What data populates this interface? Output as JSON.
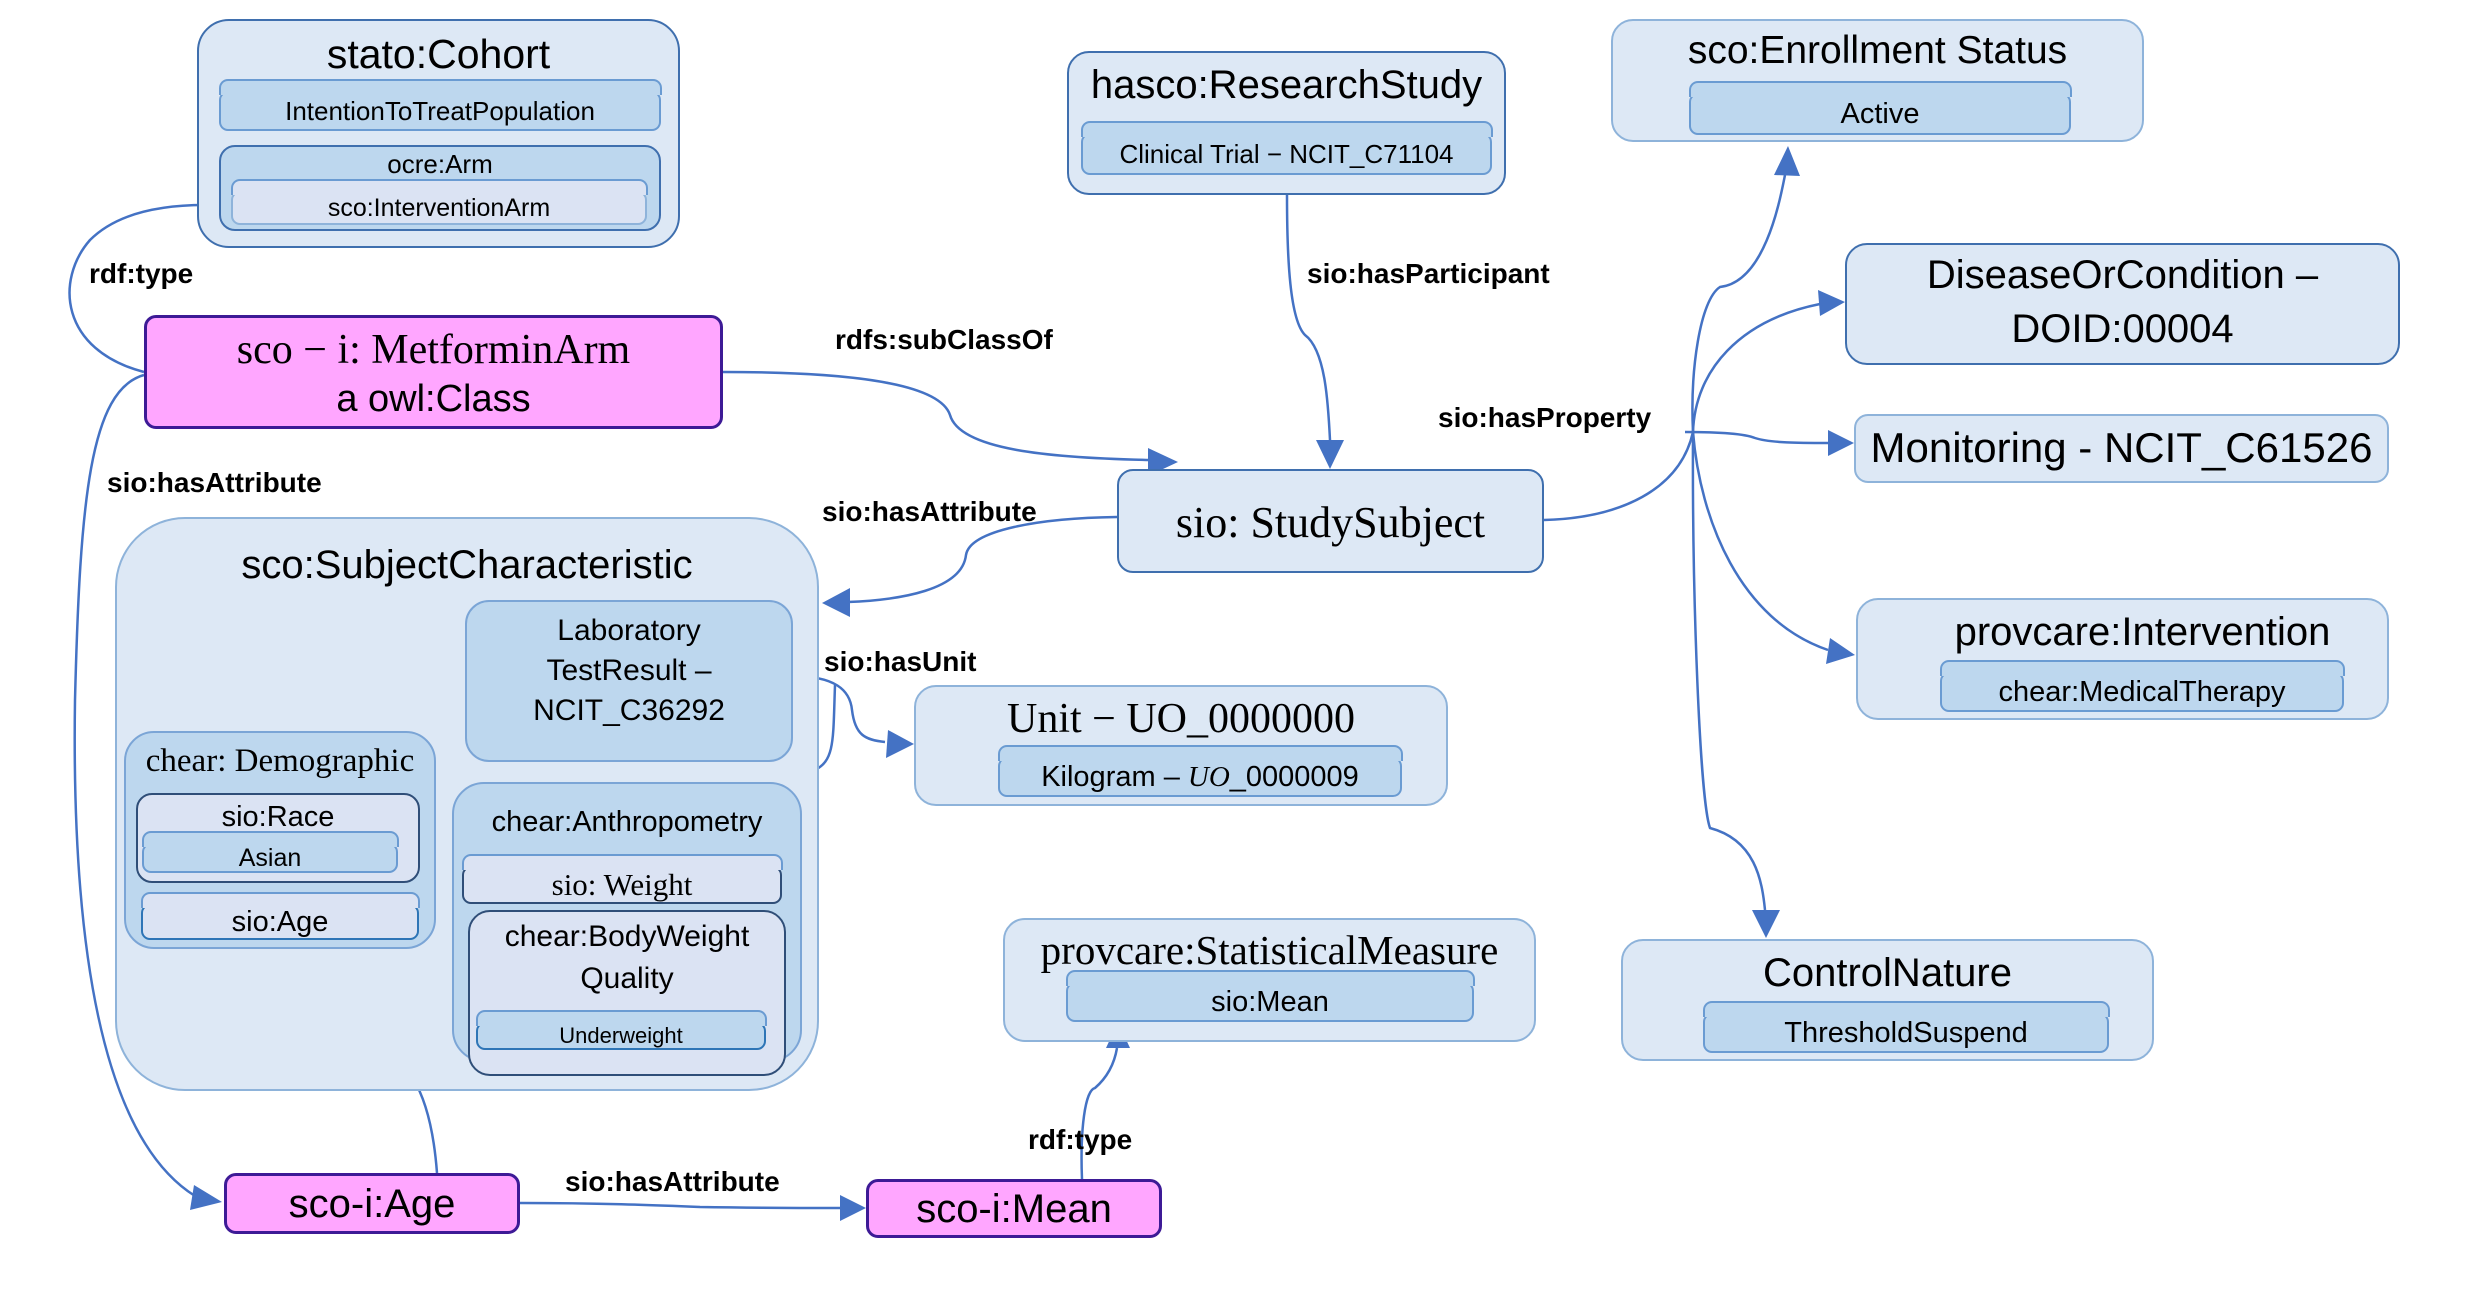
{
  "nodes": {
    "cohort": {
      "title": "stato:Cohort",
      "items": [
        "IntentionToTreatPopulation"
      ],
      "arm": {
        "title": "ocre:Arm",
        "item": "sco:InterventionArm"
      }
    },
    "research_study": {
      "title": "hasco:ResearchStudy",
      "item": "Clinical Trial − NCIT_C71104"
    },
    "enrollment_status": {
      "title": "sco:Enrollment Status",
      "item": "Active"
    },
    "disease": {
      "line1": "DiseaseOrCondition –",
      "line2": "DOID:00004"
    },
    "metformin_arm": {
      "line1": "sco − i: MetforminArm",
      "line2": "a owl:Class"
    },
    "monitoring": {
      "title": "Monitoring - NCIT_C61526"
    },
    "study_subject": {
      "title": "sio: StudySubject"
    },
    "subject_characteristic": {
      "title": "sco:SubjectCharacteristic",
      "lab": {
        "line1": "Laboratory",
        "line2": "TestResult –",
        "line3": "NCIT_C36292"
      },
      "demographic": {
        "title": "chear: Demographic",
        "race": {
          "title": "sio:Race",
          "item": "Asian"
        },
        "age": "sio:Age"
      },
      "anthropometry": {
        "title": "chear:Anthropometry",
        "weight": "sio: Weight",
        "bodyweight": {
          "line1": "chear:BodyWeight",
          "line2": "Quality",
          "item": "Underweight"
        }
      }
    },
    "unit": {
      "title": "Unit − UO_0000000",
      "item_prefix": "Kilogram – ",
      "item_italic": "UO",
      "item_suffix": "_0000009"
    },
    "intervention": {
      "title": "provcare:Intervention",
      "item": "chear:MedicalTherapy"
    },
    "statistical_measure": {
      "title": "provcare:StatisticalMeasure",
      "item": "sio:Mean"
    },
    "control_nature": {
      "title": "ControlNature",
      "item": "ThresholdSuspend"
    },
    "sco_i_age": {
      "title": "sco-i:Age"
    },
    "sco_i_mean": {
      "title": "sco-i:Mean"
    }
  },
  "edges": {
    "rdf_type_cohort": "rdf:type",
    "subclassof": "rdfs:subClassOf",
    "has_attribute_left": "sio:hasAttribute",
    "has_participant": "sio:hasParticipant",
    "has_property": "sio:hasProperty",
    "has_attribute_subject": "sio:hasAttribute",
    "has_unit": "sio:hasUnit",
    "rdf_type_mean": "rdf:type",
    "has_attribute_bottom": "sio:hasAttribute"
  },
  "colors": {
    "edge": "#4472c4",
    "instance_fill": "#ffa6ff",
    "class_fill": "#dde8f5",
    "item_fill": "#bdd7ee"
  }
}
